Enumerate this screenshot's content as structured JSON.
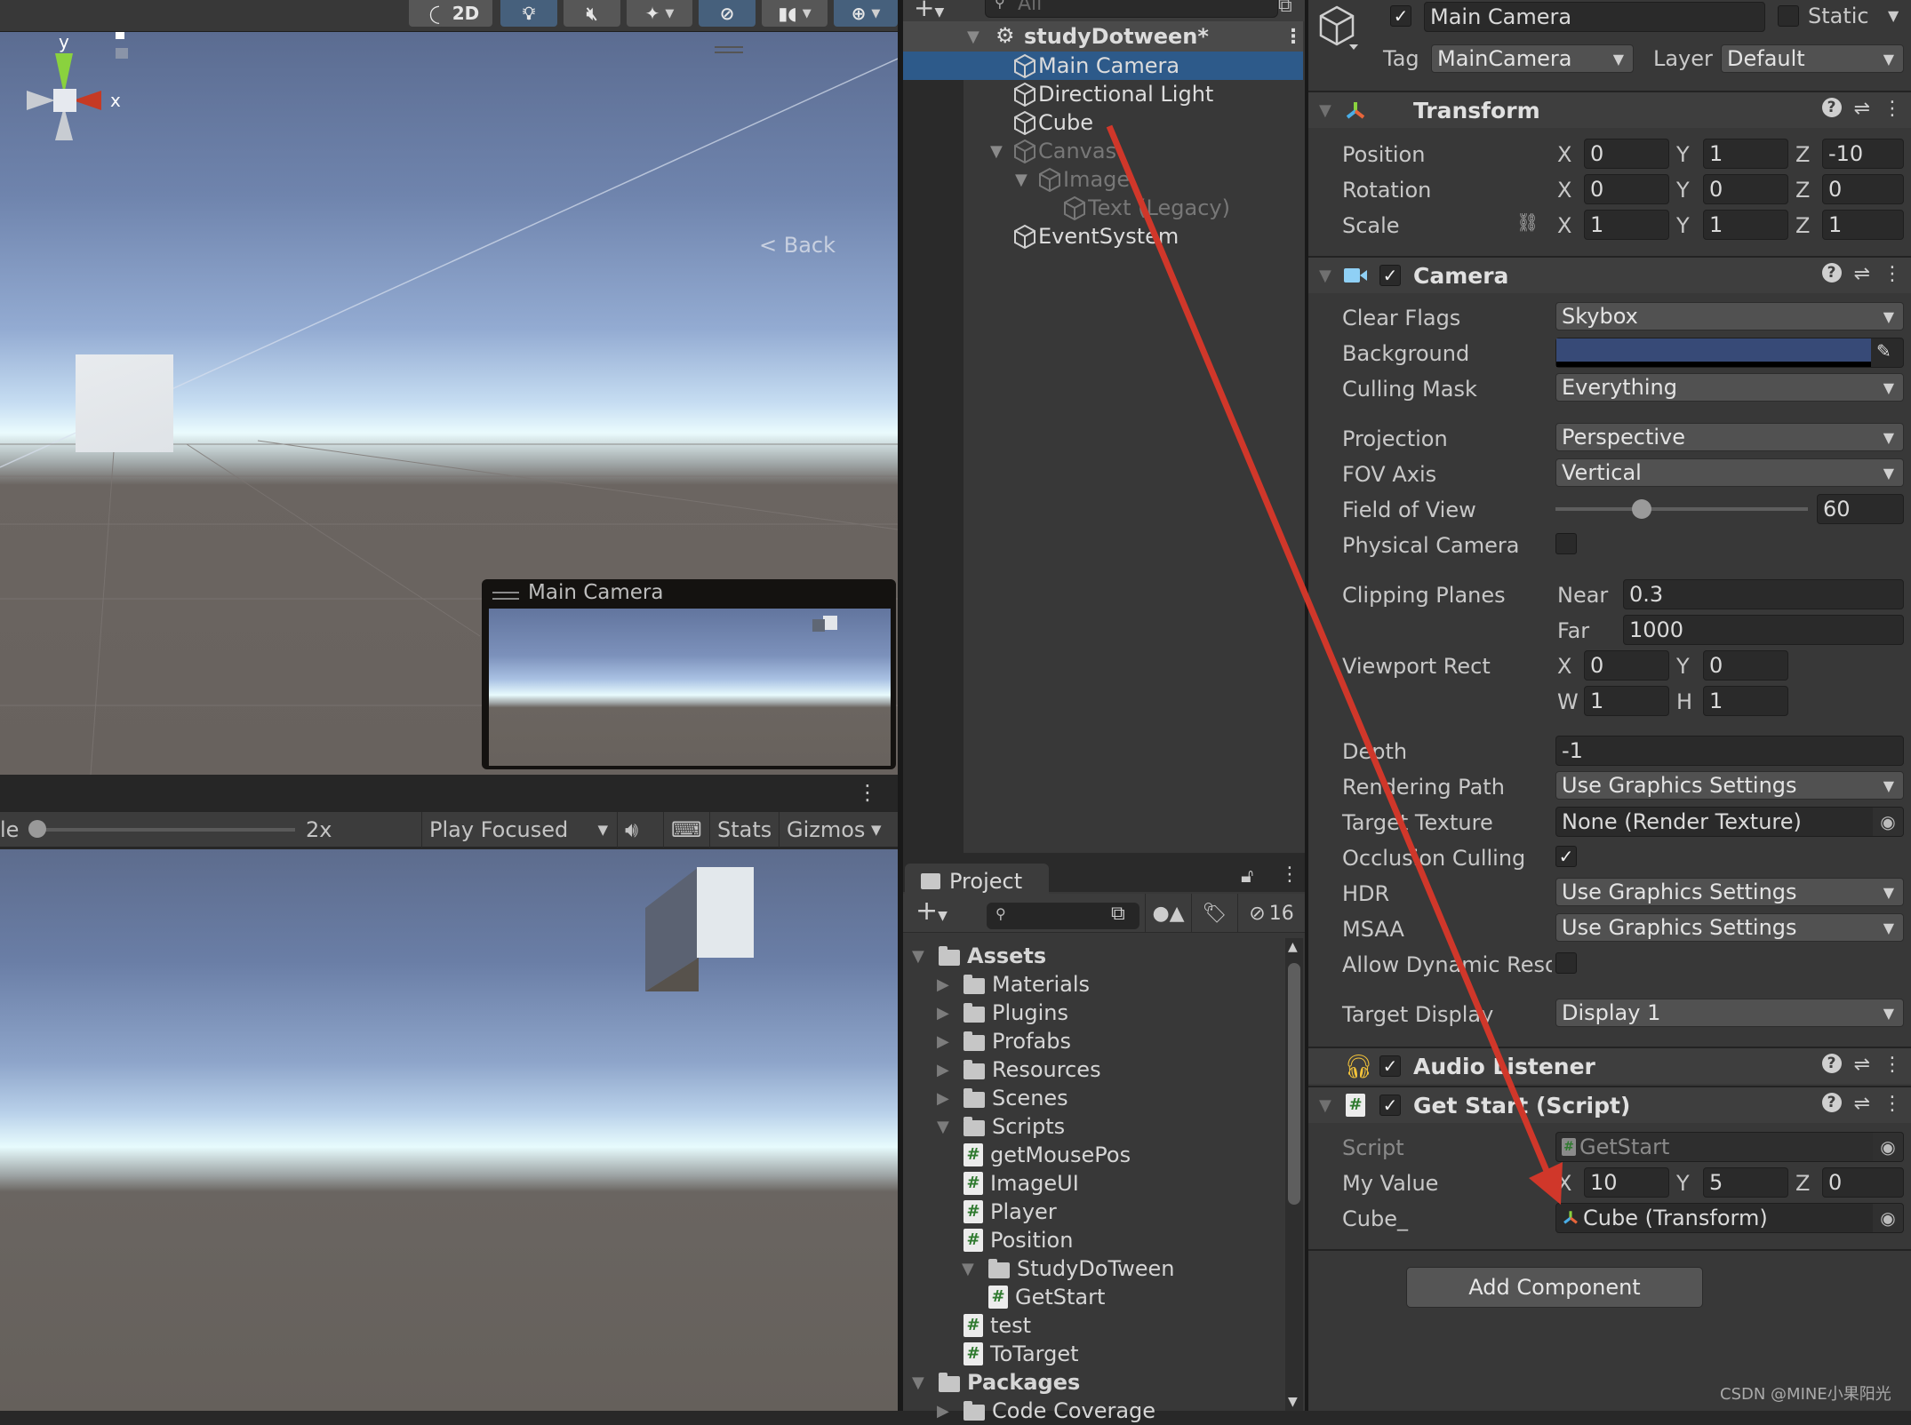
{
  "scene_toolbar": {
    "buttons": [
      {
        "name": "shading-mode",
        "icon": "sphere-icon"
      },
      {
        "name": "2d-toggle",
        "label": "2D"
      },
      {
        "name": "lighting-toggle",
        "icon": "lightbulb-icon",
        "active": true
      },
      {
        "name": "audio-toggle",
        "icon": "audio-mute-icon"
      },
      {
        "name": "effects-toggle",
        "icon": "effects-icon"
      },
      {
        "name": "visibility-toggle",
        "icon": "eye-slash-icon",
        "active": true
      },
      {
        "name": "camera-toggle",
        "icon": "camera-icon"
      },
      {
        "name": "gizmos-toggle",
        "icon": "globe-icon",
        "active": true
      }
    ]
  },
  "scene_view": {
    "gizmo_axes": {
      "y": "y",
      "x": "x"
    },
    "back_label": "Back",
    "camera_preview_title": "Main Camera"
  },
  "game_toolbar": {
    "scale_label": "le",
    "scale_value": "2x",
    "scale_fraction": 0.0,
    "play_mode": "Play Focused",
    "stats": "Stats",
    "gizmos": "Gizmos"
  },
  "hierarchy": {
    "search_placeholder": "All",
    "scene_name": "studyDotween*",
    "items": [
      {
        "label": "Main Camera",
        "depth": 1,
        "selected": true,
        "enabled": true
      },
      {
        "label": "Directional Light",
        "depth": 1,
        "enabled": true
      },
      {
        "label": "Cube",
        "depth": 1,
        "enabled": true
      },
      {
        "label": "Canvas",
        "depth": 1,
        "expanded": true,
        "enabled": false
      },
      {
        "label": "Image",
        "depth": 2,
        "expanded": true,
        "enabled": false
      },
      {
        "label": "Text (Legacy)",
        "depth": 3,
        "enabled": false
      },
      {
        "label": "EventSystem",
        "depth": 1,
        "enabled": true
      }
    ]
  },
  "project": {
    "tab_label": "Project",
    "hidden_count": "16",
    "tree": [
      {
        "label": "Assets",
        "type": "folder-open",
        "depth": 0,
        "bold": true
      },
      {
        "label": "Materials",
        "type": "folder",
        "depth": 1
      },
      {
        "label": "Plugins",
        "type": "folder",
        "depth": 1
      },
      {
        "label": "Profabs",
        "type": "folder",
        "depth": 1
      },
      {
        "label": "Resources",
        "type": "folder",
        "depth": 1
      },
      {
        "label": "Scenes",
        "type": "folder",
        "depth": 1
      },
      {
        "label": "Scripts",
        "type": "folder-open",
        "depth": 1
      },
      {
        "label": "getMousePos",
        "type": "script",
        "depth": 2
      },
      {
        "label": "ImageUI",
        "type": "script",
        "depth": 2
      },
      {
        "label": "Player",
        "type": "script",
        "depth": 2
      },
      {
        "label": "Position",
        "type": "script",
        "depth": 2
      },
      {
        "label": "StudyDoTween",
        "type": "folder-open",
        "depth": 2
      },
      {
        "label": "GetStart",
        "type": "script",
        "depth": 3
      },
      {
        "label": "test",
        "type": "script",
        "depth": 2
      },
      {
        "label": "ToTarget",
        "type": "script",
        "depth": 2
      },
      {
        "label": "Packages",
        "type": "folder-open",
        "depth": 0,
        "bold": true
      },
      {
        "label": "Code Coverage",
        "type": "folder",
        "depth": 1
      }
    ]
  },
  "inspector": {
    "object_name": "Main Camera",
    "active": true,
    "static_label": "Static",
    "static": false,
    "tag_label": "Tag",
    "tag": "MainCamera",
    "layer_label": "Layer",
    "layer": "Default",
    "transform": {
      "title": "Transform",
      "position": {
        "label": "Position",
        "x": "0",
        "y": "1",
        "z": "-10"
      },
      "rotation": {
        "label": "Rotation",
        "x": "0",
        "y": "0",
        "z": "0"
      },
      "scale": {
        "label": "Scale",
        "x": "1",
        "y": "1",
        "z": "1"
      }
    },
    "camera": {
      "title": "Camera",
      "enabled": true,
      "clear_flags": {
        "label": "Clear Flags",
        "value": "Skybox"
      },
      "background": {
        "label": "Background",
        "color": "#374a77"
      },
      "culling_mask": {
        "label": "Culling Mask",
        "value": "Everything"
      },
      "projection": {
        "label": "Projection",
        "value": "Perspective"
      },
      "fov_axis": {
        "label": "FOV Axis",
        "value": "Vertical"
      },
      "field_of_view": {
        "label": "Field of View",
        "value": "60",
        "slider_fraction": 0.34
      },
      "physical_camera": {
        "label": "Physical Camera",
        "checked": false
      },
      "clipping_planes": {
        "label": "Clipping Planes",
        "near_label": "Near",
        "near": "0.3",
        "far_label": "Far",
        "far": "1000"
      },
      "viewport_rect": {
        "label": "Viewport Rect",
        "x": "0",
        "y": "0",
        "w": "1",
        "h": "1"
      },
      "depth": {
        "label": "Depth",
        "value": "-1"
      },
      "rendering_path": {
        "label": "Rendering Path",
        "value": "Use Graphics Settings"
      },
      "target_texture": {
        "label": "Target Texture",
        "value": "None (Render Texture)"
      },
      "occlusion_culling": {
        "label": "Occlusion Culling",
        "checked": true
      },
      "hdr": {
        "label": "HDR",
        "value": "Use Graphics Settings"
      },
      "msaa": {
        "label": "MSAA",
        "value": "Use Graphics Settings"
      },
      "dynamic_resolution": {
        "label": "Allow Dynamic Resol",
        "checked": false
      },
      "target_display": {
        "label": "Target Display",
        "value": "Display 1"
      }
    },
    "audio_listener": {
      "title": "Audio Listener",
      "enabled": true
    },
    "get_start": {
      "title": "Get Start (Script)",
      "enabled": true,
      "script": {
        "label": "Script",
        "value": "GetStart"
      },
      "my_value": {
        "label": "My Value",
        "x": "10",
        "y": "5",
        "z": "0"
      },
      "cube": {
        "label": "Cube_",
        "value": "Cube (Transform)"
      }
    },
    "add_component": "Add Component"
  },
  "axis_labels": {
    "x": "X",
    "y": "Y",
    "z": "Z",
    "w": "W",
    "h": "H"
  },
  "watermark": "CSDN @MINE小果阳光",
  "annotation_color": "#d0372a"
}
